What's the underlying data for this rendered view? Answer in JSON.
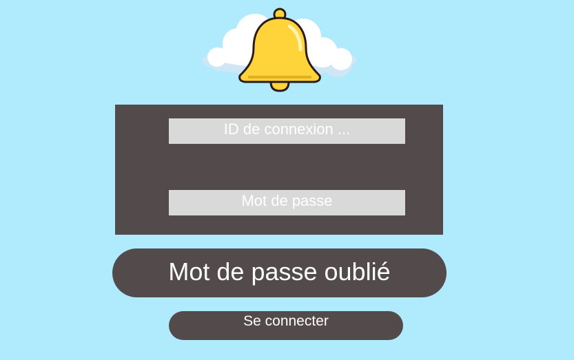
{
  "logo": {
    "icon": "bell-icon",
    "decoration": "cloud",
    "colors": {
      "bell": "#ffd43b",
      "outline": "#2b1a16",
      "cloud": "#ffffff",
      "cloud_shadow": "#cfe6f5"
    }
  },
  "form": {
    "login_id_placeholder": "ID de connexion ...",
    "password_placeholder": "Mot de passe"
  },
  "buttons": {
    "forgot_password_label": "Mot de passe oublié",
    "connect_label": "Se connecter"
  },
  "colors": {
    "background": "#b0eafd",
    "panel": "#524a4b",
    "field": "#d9d9d9",
    "text": "#ffffff"
  }
}
